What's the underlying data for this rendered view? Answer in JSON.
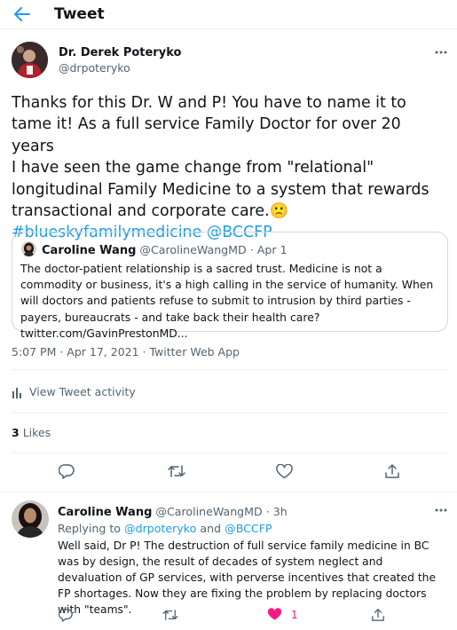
{
  "header": {
    "title": "Tweet"
  },
  "tweet": {
    "author_name": "Dr. Derek Poteryko",
    "author_handle": "@drpoteryko",
    "text_lines": [
      "Thanks for this Dr. W and P! You have to name it to",
      "tame it! As a full service Family Doctor for over 20 years",
      "I have seen the game change from \"relational\"",
      "longitudinal Family Medicine to a system that rewards",
      "transactional and corporate care."
    ],
    "emoji": "🙁",
    "hashtag": "#blueskyfamilymedicine",
    "mention": "@BCCFP",
    "quote": {
      "name": "Caroline Wang",
      "handle": "@CarolineWangMD",
      "separator": "·",
      "date": "Apr 1",
      "text": "The doctor-patient relationship is a sacred trust. Medicine is not a commodity or business, it's a high calling in the service of humanity. When will doctors and patients refuse to submit to intrusion by third parties - payers, bureaucrats - and take back their health care? twitter.com/GavinPrestonMD..."
    },
    "timestamp": "5:07 PM · Apr 17, 2021 · Twitter Web App",
    "activity_label": "View Tweet activity",
    "likes_count": "3",
    "likes_label": "Likes"
  },
  "reply": {
    "name": "Caroline Wang",
    "handle": "@CarolineWangMD",
    "separator": "·",
    "time": "3h",
    "replying_prefix": "Replying to",
    "replying_mention_1": "@drpoteryko",
    "replying_and": "and",
    "replying_mention_2": "@BCCFP",
    "text": "Well said, Dr P! The destruction of full service family medicine in BC was by design, the result of decades of system neglect and devaluation of GP services, with perverse incentives that created the FP shortages. Now they are fixing the problem by replacing doctors with \"teams\".",
    "likes": "1"
  },
  "colors": {
    "accent": "#1d9bf0",
    "like": "#f91880",
    "muted": "#536471"
  },
  "icons": [
    "back-arrow-icon",
    "more-icon",
    "bar-chart-icon",
    "reply-icon",
    "retweet-icon",
    "heart-icon",
    "share-icon"
  ]
}
